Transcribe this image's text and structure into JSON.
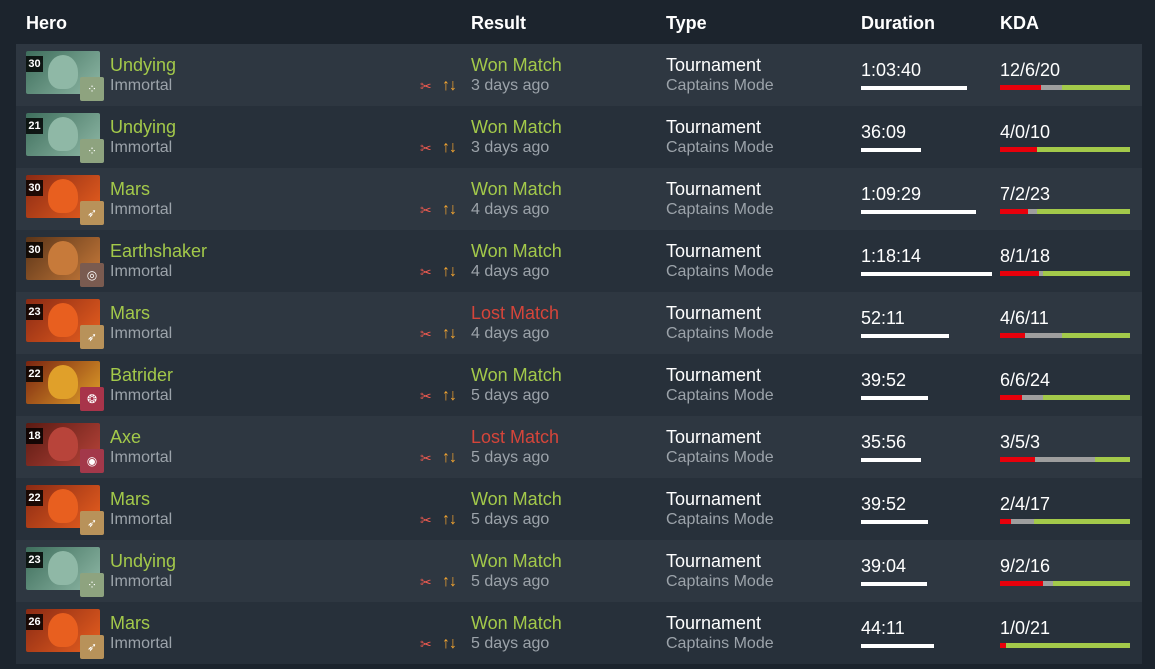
{
  "headers": {
    "hero": "Hero",
    "result": "Result",
    "type": "Type",
    "duration": "Duration",
    "kda": "KDA"
  },
  "colors": {
    "won": "#a3c94a",
    "lost": "#d5453a",
    "kills": "#e8000b",
    "deaths": "#9e9e9e",
    "assists": "#a3c94a",
    "duration_bar": "#ffffff"
  },
  "matches": [
    {
      "hero": "Undying",
      "level": "30",
      "rank": "Immortal",
      "hero_colors": [
        "#3e6e5c",
        "#8fb8a6"
      ],
      "badge_color": "#8ea37f",
      "badge_icon": "dice-icon",
      "badge_glyph": "⁘",
      "lane_icon": "jungle-lane-icon",
      "role_icon": "role-arrows-icon",
      "lane_glyph": "✂",
      "role_glyph": "↑↓",
      "result": "Won Match",
      "outcome": "won",
      "when": "3 days ago",
      "type": "Tournament",
      "mode": "Captains Mode",
      "duration": "1:03:40",
      "duration_fraction": 0.81,
      "kda": "12/6/20",
      "kills": 12,
      "deaths": 6,
      "assists": 20
    },
    {
      "hero": "Undying",
      "level": "21",
      "rank": "Immortal",
      "hero_colors": [
        "#3e6e5c",
        "#8fb8a6"
      ],
      "badge_color": "#8ea37f",
      "badge_icon": "dice-icon",
      "badge_glyph": "⁘",
      "lane_icon": "jungle-lane-icon",
      "role_icon": "role-arrows-icon",
      "lane_glyph": "✂",
      "role_glyph": "↑↓",
      "result": "Won Match",
      "outcome": "won",
      "when": "3 days ago",
      "type": "Tournament",
      "mode": "Captains Mode",
      "duration": "36:09",
      "duration_fraction": 0.46,
      "kda": "4/0/10",
      "kills": 4,
      "deaths": 0,
      "assists": 10
    },
    {
      "hero": "Mars",
      "level": "30",
      "rank": "Immortal",
      "hero_colors": [
        "#8a2a14",
        "#e85f1f"
      ],
      "badge_color": "#b8925a",
      "badge_icon": "spear-icon",
      "badge_glyph": "➶",
      "lane_icon": "jungle-lane-icon",
      "role_icon": "role-arrows-icon",
      "lane_glyph": "✂",
      "role_glyph": "↑↓",
      "result": "Won Match",
      "outcome": "won",
      "when": "4 days ago",
      "type": "Tournament",
      "mode": "Captains Mode",
      "duration": "1:09:29",
      "duration_fraction": 0.88,
      "kda": "7/2/23",
      "kills": 7,
      "deaths": 2,
      "assists": 23
    },
    {
      "hero": "Earthshaker",
      "level": "30",
      "rank": "Immortal",
      "hero_colors": [
        "#5a3418",
        "#c77a3a"
      ],
      "badge_color": "#7a5b50",
      "badge_icon": "ring-icon",
      "badge_glyph": "◎",
      "lane_icon": "jungle-lane-icon",
      "role_icon": "role-arrows-icon",
      "lane_glyph": "✂",
      "role_glyph": "↑↓",
      "result": "Won Match",
      "outcome": "won",
      "when": "4 days ago",
      "type": "Tournament",
      "mode": "Captains Mode",
      "duration": "1:18:14",
      "duration_fraction": 1.0,
      "kda": "8/1/18",
      "kills": 8,
      "deaths": 1,
      "assists": 18
    },
    {
      "hero": "Mars",
      "level": "23",
      "rank": "Immortal",
      "hero_colors": [
        "#8a2a14",
        "#e85f1f"
      ],
      "badge_color": "#b8925a",
      "badge_icon": "spear-icon",
      "badge_glyph": "➶",
      "lane_icon": "jungle-lane-icon",
      "role_icon": "role-arrows-icon",
      "lane_glyph": "✂",
      "role_glyph": "↑↓",
      "result": "Lost Match",
      "outcome": "lost",
      "when": "4 days ago",
      "type": "Tournament",
      "mode": "Captains Mode",
      "duration": "52:11",
      "duration_fraction": 0.67,
      "kda": "4/6/11",
      "kills": 4,
      "deaths": 6,
      "assists": 11
    },
    {
      "hero": "Batrider",
      "level": "22",
      "rank": "Immortal",
      "hero_colors": [
        "#7a2410",
        "#e0a02a"
      ],
      "badge_color": "#a8344a",
      "badge_icon": "fire-icon",
      "badge_glyph": "❂",
      "lane_icon": "jungle-lane-icon",
      "role_icon": "role-arrows-icon",
      "lane_glyph": "✂",
      "role_glyph": "↑↓",
      "result": "Won Match",
      "outcome": "won",
      "when": "5 days ago",
      "type": "Tournament",
      "mode": "Captains Mode",
      "duration": "39:52",
      "duration_fraction": 0.51,
      "kda": "6/6/24",
      "kills": 6,
      "deaths": 6,
      "assists": 24
    },
    {
      "hero": "Axe",
      "level": "18",
      "rank": "Immortal",
      "hero_colors": [
        "#5a1a12",
        "#b8443a"
      ],
      "badge_color": "#a3384a",
      "badge_icon": "target-icon",
      "badge_glyph": "◉",
      "lane_icon": "jungle-lane-icon",
      "role_icon": "role-arrows-icon",
      "lane_glyph": "✂",
      "role_glyph": "↑↓",
      "result": "Lost Match",
      "outcome": "lost",
      "when": "5 days ago",
      "type": "Tournament",
      "mode": "Captains Mode",
      "duration": "35:56",
      "duration_fraction": 0.46,
      "kda": "3/5/3",
      "kills": 3,
      "deaths": 5,
      "assists": 3
    },
    {
      "hero": "Mars",
      "level": "22",
      "rank": "Immortal",
      "hero_colors": [
        "#8a2a14",
        "#e85f1f"
      ],
      "badge_color": "#b8925a",
      "badge_icon": "spear-icon",
      "badge_glyph": "➶",
      "lane_icon": "jungle-lane-icon",
      "role_icon": "role-arrows-icon",
      "lane_glyph": "✂",
      "role_glyph": "↑↓",
      "result": "Won Match",
      "outcome": "won",
      "when": "5 days ago",
      "type": "Tournament",
      "mode": "Captains Mode",
      "duration": "39:52",
      "duration_fraction": 0.51,
      "kda": "2/4/17",
      "kills": 2,
      "deaths": 4,
      "assists": 17
    },
    {
      "hero": "Undying",
      "level": "23",
      "rank": "Immortal",
      "hero_colors": [
        "#3e6e5c",
        "#8fb8a6"
      ],
      "badge_color": "#8ea37f",
      "badge_icon": "dice-icon",
      "badge_glyph": "⁘",
      "lane_icon": "jungle-lane-icon",
      "role_icon": "role-arrows-icon",
      "lane_glyph": "✂",
      "role_glyph": "↑↓",
      "result": "Won Match",
      "outcome": "won",
      "when": "5 days ago",
      "type": "Tournament",
      "mode": "Captains Mode",
      "duration": "39:04",
      "duration_fraction": 0.5,
      "kda": "9/2/16",
      "kills": 9,
      "deaths": 2,
      "assists": 16
    },
    {
      "hero": "Mars",
      "level": "26",
      "rank": "Immortal",
      "hero_colors": [
        "#8a2a14",
        "#e85f1f"
      ],
      "badge_color": "#b8925a",
      "badge_icon": "spear-icon",
      "badge_glyph": "➶",
      "lane_icon": "jungle-lane-icon",
      "role_icon": "role-arrows-icon",
      "lane_glyph": "✂",
      "role_glyph": "↑↓",
      "result": "Won Match",
      "outcome": "won",
      "when": "5 days ago",
      "type": "Tournament",
      "mode": "Captains Mode",
      "duration": "44:11",
      "duration_fraction": 0.56,
      "kda": "1/0/21",
      "kills": 1,
      "deaths": 0,
      "assists": 21
    }
  ]
}
